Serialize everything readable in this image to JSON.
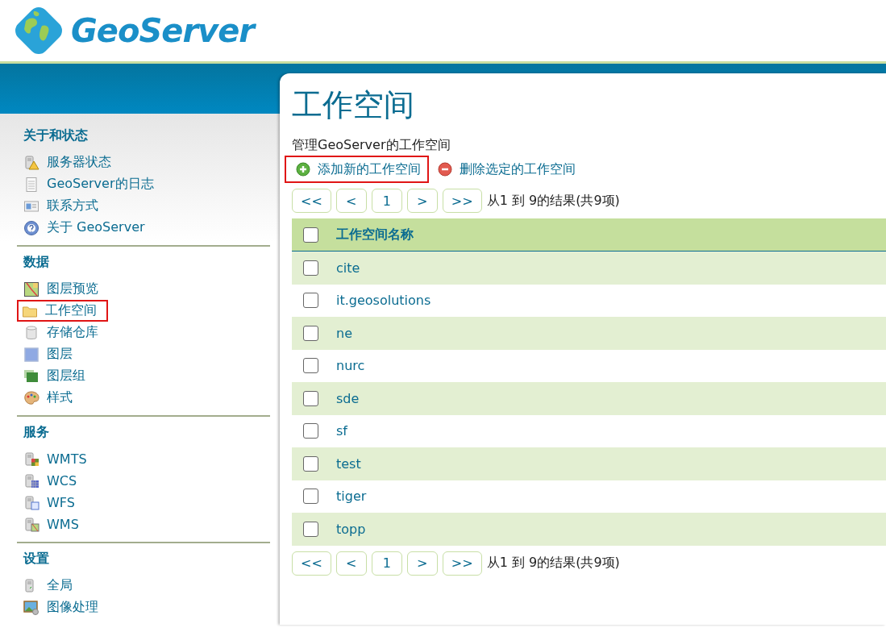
{
  "logo": {
    "text": "GeoServer"
  },
  "sidebar": {
    "sections": [
      {
        "heading": "关于和状态",
        "items": [
          {
            "label": "服务器状态",
            "highlighted": false
          },
          {
            "label": "GeoServer的日志",
            "highlighted": false
          },
          {
            "label": "联系方式",
            "highlighted": false
          },
          {
            "label": "关于 GeoServer",
            "highlighted": false
          }
        ]
      },
      {
        "heading": "数据",
        "items": [
          {
            "label": "图层预览",
            "highlighted": false
          },
          {
            "label": "工作空间",
            "highlighted": true
          },
          {
            "label": "存储仓库",
            "highlighted": false
          },
          {
            "label": "图层",
            "highlighted": false
          },
          {
            "label": "图层组",
            "highlighted": false
          },
          {
            "label": "样式",
            "highlighted": false
          }
        ]
      },
      {
        "heading": "服务",
        "items": [
          {
            "label": "WMTS",
            "highlighted": false
          },
          {
            "label": "WCS",
            "highlighted": false
          },
          {
            "label": "WFS",
            "highlighted": false
          },
          {
            "label": "WMS",
            "highlighted": false
          }
        ]
      },
      {
        "heading": "设置",
        "items": [
          {
            "label": "全局",
            "highlighted": false
          },
          {
            "label": "图像处理",
            "highlighted": false
          }
        ]
      }
    ]
  },
  "page": {
    "title": "工作空间",
    "description": "管理GeoServer的工作空间",
    "actions": [
      {
        "kind": "add",
        "label": "添加新的工作空间",
        "highlighted": true
      },
      {
        "kind": "remove",
        "label": "删除选定的工作空间",
        "highlighted": false
      }
    ],
    "pager_top": {
      "buttons": [
        "<<",
        "<",
        "1",
        ">",
        ">>"
      ],
      "summary": "从1 到 9的结果(共9项)"
    },
    "table": {
      "header": {
        "label": "工作空间名称",
        "checked": false
      },
      "rows": [
        {
          "name": "cite",
          "checked": false
        },
        {
          "name": "it.geosolutions",
          "checked": false
        },
        {
          "name": "ne",
          "checked": false
        },
        {
          "name": "nurc",
          "checked": false
        },
        {
          "name": "sde",
          "checked": false
        },
        {
          "name": "sf",
          "checked": false
        },
        {
          "name": "test",
          "checked": false
        },
        {
          "name": "tiger",
          "checked": false
        },
        {
          "name": "topp",
          "checked": false
        }
      ]
    },
    "pager_bottom": {
      "buttons": [
        "<<",
        "<",
        "1",
        ">",
        ">>"
      ],
      "summary": "从1 到 9的结果(共9项)"
    }
  }
}
